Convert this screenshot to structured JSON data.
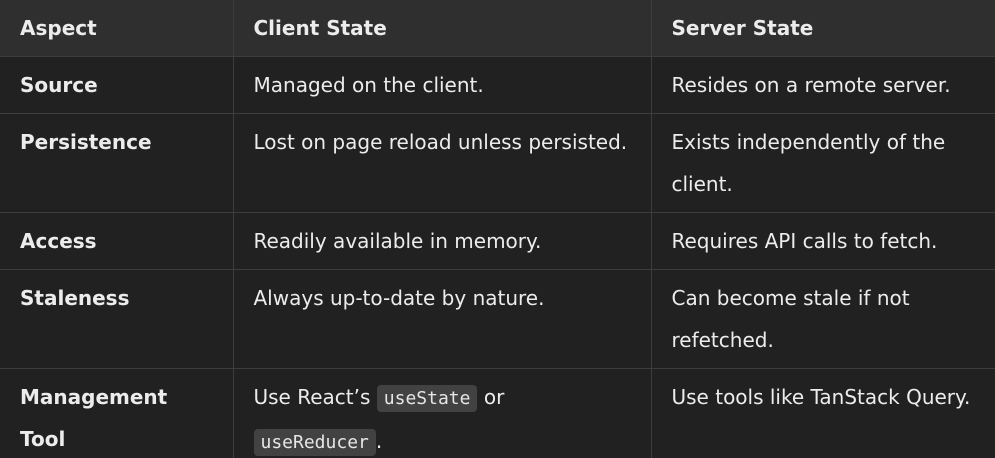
{
  "table": {
    "headers": [
      "Aspect",
      "Client State",
      "Server State"
    ],
    "rows": [
      {
        "aspect": "Source",
        "client": "Managed on the client.",
        "server": "Resides on a remote server."
      },
      {
        "aspect": "Persistence",
        "client": "Lost on page reload unless persisted.",
        "server": "Exists independently of the client."
      },
      {
        "aspect": "Access",
        "client": "Readily available in memory.",
        "server": "Requires API calls to fetch."
      },
      {
        "aspect": "Staleness",
        "client": "Always up-to-date by nature.",
        "server": "Can become stale if not refetched."
      },
      {
        "aspect": "Management Tool",
        "client_parts": {
          "prefix": "Use React’s ",
          "code1": "useState",
          "middle": " or ",
          "code2": "useReducer",
          "suffix": "."
        },
        "server": "Use tools like TanStack Query."
      }
    ]
  }
}
